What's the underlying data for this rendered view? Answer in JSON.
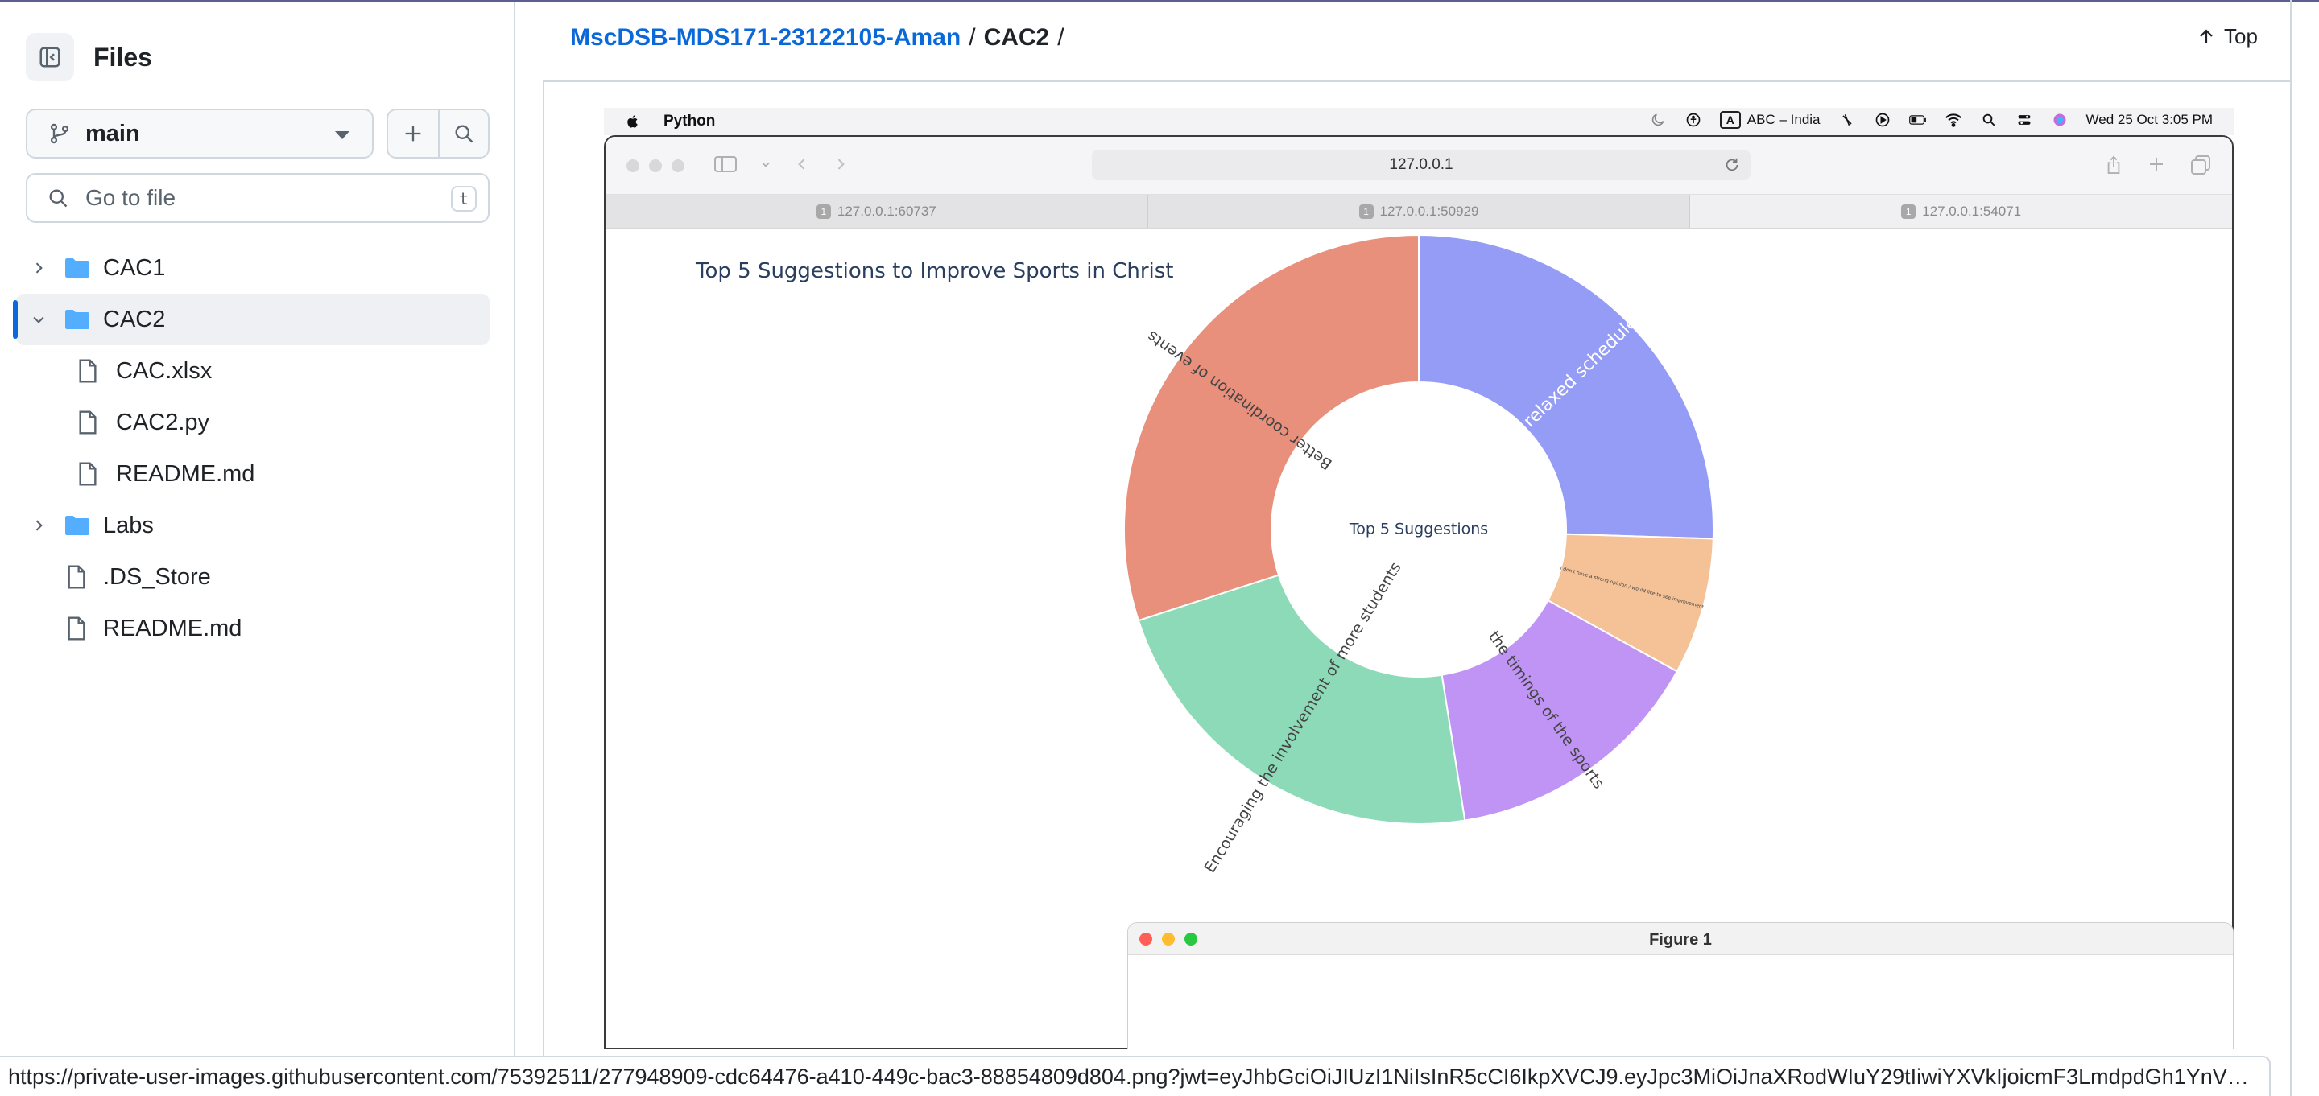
{
  "sidebar": {
    "title": "Files",
    "branch": "main",
    "goto_placeholder": "Go to file",
    "goto_shortcut": "t",
    "tree": [
      {
        "label": "CAC1",
        "type": "folder",
        "expanded": false,
        "depth": 0
      },
      {
        "label": "CAC2",
        "type": "folder",
        "expanded": true,
        "depth": 0,
        "active": true
      },
      {
        "label": "CAC.xlsx",
        "type": "file",
        "depth": 1
      },
      {
        "label": "CAC2.py",
        "type": "file",
        "depth": 1
      },
      {
        "label": "README.md",
        "type": "file",
        "depth": 1
      },
      {
        "label": "Labs",
        "type": "folder",
        "expanded": false,
        "depth": 0
      },
      {
        "label": ".DS_Store",
        "type": "file",
        "depth": 0
      },
      {
        "label": "README.md",
        "type": "file",
        "depth": 0
      }
    ]
  },
  "header": {
    "repo": "MscDSB-MDS171-23122105-Aman",
    "sep": "/",
    "dir": "CAC2",
    "sep2": "/",
    "top_label": "Top"
  },
  "screenshot": {
    "menubar": {
      "app": "Python",
      "input_source": "ABC – India",
      "input_badge": "A",
      "clock": "Wed 25 Oct  3:05 PM"
    },
    "browser": {
      "url": "127.0.0.1",
      "tabs": [
        {
          "num": "1",
          "label": "127.0.0.1:60737"
        },
        {
          "num": "1",
          "label": "127.0.0.1:50929"
        },
        {
          "num": "1",
          "label": "127.0.0.1:54071"
        }
      ]
    },
    "chart_data": {
      "type": "pie",
      "hole": 0.5,
      "title": "Top 5 Suggestions to Improve Sports in Christ",
      "center_label": "Top 5 Suggestions",
      "slices": [
        {
          "label": "A bit more relaxed schedule of events",
          "value": 25.5,
          "color": "#959cf5"
        },
        {
          "label": "I don't have a strong opinion / would like to see improvement",
          "value": 7.5,
          "color": "#f5c196"
        },
        {
          "label": "the timings of the sports",
          "value": 14.5,
          "color": "#bf94f5"
        },
        {
          "label": "Encouraging the involvement of more students",
          "value": 22.5,
          "color": "#8ddab8"
        },
        {
          "label": "Better coordination of events",
          "value": 30.0,
          "color": "#e8907c"
        }
      ]
    },
    "figure_window": {
      "title": "Figure 1"
    }
  },
  "status_url": "https://private-user-images.githubusercontent.com/75392511/277948909-cdc64476-a410-449c-bac3-88854809d804.png?jwt=eyJhbGciOiJIUzI1NiIsInR5cCI6IkpXVCJ9.eyJpc3MiOiJnaXRodWIuY29tIiwiYXVkIjoicmF3LmdpdGh1YnVzZXJjb250Z..."
}
